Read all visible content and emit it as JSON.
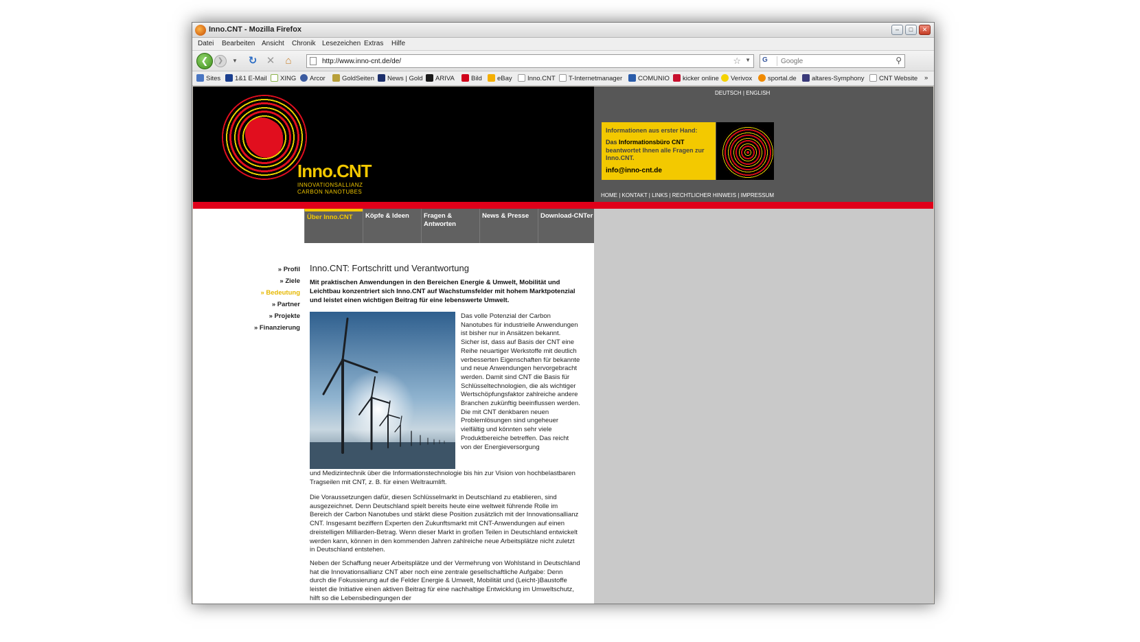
{
  "window": {
    "title": "Inno.CNT - Mozilla Firefox"
  },
  "menu": [
    "Datei",
    "Bearbeiten",
    "Ansicht",
    "Chronik",
    "Lesezeichen",
    "Extras",
    "Hilfe"
  ],
  "url": "http://www.inno-cnt.de/de/",
  "search": {
    "engine": "G",
    "placeholder": "Google"
  },
  "bookmarks": [
    "Sites",
    "1&1 E-Mail",
    "XING",
    "Arcor",
    "GoldSeiten",
    "News | Gold",
    "ARIVA",
    "Bild",
    "eBay",
    "Inno.CNT",
    "T-Internetmanager",
    "COMUNIO",
    "kicker online",
    "Verivox",
    "sportal.de",
    "altares-Symphony",
    "CNT Website"
  ],
  "header": {
    "lang": "DEUTSCH | ENGLISH",
    "logo": {
      "name": "Inno.CNT",
      "sub1": "INNOVATIONSALLIANZ",
      "sub2": "CARBON NANOTUBES"
    },
    "info": {
      "line1": "Informationen aus erster Hand:",
      "line2_pre": "Das ",
      "line2_bold": "Informationsbüro CNT",
      "line3": "beantwortet Ihnen alle Fragen zur Inno.CNT.",
      "email": "info@inno-cnt.de"
    },
    "topnav": "HOME | KONTAKT | LINKS | RECHTLICHER HINWEIS | IMPRESSUM"
  },
  "tabs": [
    "Über Inno.CNT",
    "Köpfe & Ideen",
    "Fragen & Antworten",
    "News & Presse",
    "Download-CNTer"
  ],
  "sidenav": [
    "» Profil",
    "» Ziele",
    "» Bedeutung",
    "» Partner",
    "» Projekte",
    "» Finanzierung"
  ],
  "article": {
    "title": "Inno.CNT: Fortschritt und Verantwortung",
    "intro": "Mit praktischen Anwendungen in den Bereichen Energie & Umwelt, Mobilität und Leichtbau konzentriert sich Inno.CNT auf Wachstumsfelder mit hohem Marktpotenzial und leistet einen wichtigen Beitrag für eine lebenswerte Umwelt.",
    "p1a": "Das volle Potenzial der Carbon Nanotubes für industrielle Anwendungen ist bisher nur in Ansätzen bekannt. Sicher ist, dass auf Basis der CNT eine Reihe neuartiger Werkstoffe mit deutlich verbesserten Eigenschaften für bekannte und neue Anwendungen hervorgebracht werden. Damit sind CNT die Basis für Schlüsseltechnologien, die als wichtiger Wertschöpfungsfaktor zahlreiche andere Branchen zukünftig beeinflussen werden. Die mit CNT denkbaren neuen Problemlösungen sind ungeheuer vielfältig und könnten sehr viele Produktbereiche betreffen. Das reicht von der Energieversorgung",
    "p1b": "und Medizintechnik über die Informationstechnologie bis hin zur Vision von hochbelastbaren Tragseilen mit CNT, z. B. für einen Weltraumlift.",
    "p2": "Die Voraussetzungen dafür, diesen Schlüsselmarkt in Deutschland zu etablieren, sind ausgezeichnet. Denn Deutschland spielt bereits heute eine weltweit führende Rolle im Bereich der Carbon Nanotubes und stärkt diese Position zusätzlich mit der Innovationsallianz CNT. Insgesamt beziffern Experten den Zukunftsmarkt mit CNT-Anwendungen auf einen dreistelligen Milliarden-Betrag. Wenn dieser Markt in großen Teilen in Deutschland entwickelt werden kann, können in den kommenden Jahren zahlreiche neue Arbeitsplätze nicht zuletzt in Deutschland entstehen.",
    "p3": "Neben der Schaffung neuer Arbeitsplätze und der Vermehrung von Wohlstand in Deutschland hat die Innovationsallianz CNT aber noch eine zentrale gesellschaftliche Aufgabe: Denn durch die Fokussierung auf die Felder Energie & Umwelt, Mobilität und (Leicht-)Baustoffe leistet die Initiative einen aktiven Beitrag für eine nachhaltige Entwicklung im Umweltschutz, hilft so die Lebensbedingungen der"
  },
  "colors": {
    "accent_yellow": "#f3c900",
    "accent_red": "#e0001a",
    "header_gray": "#575757"
  }
}
